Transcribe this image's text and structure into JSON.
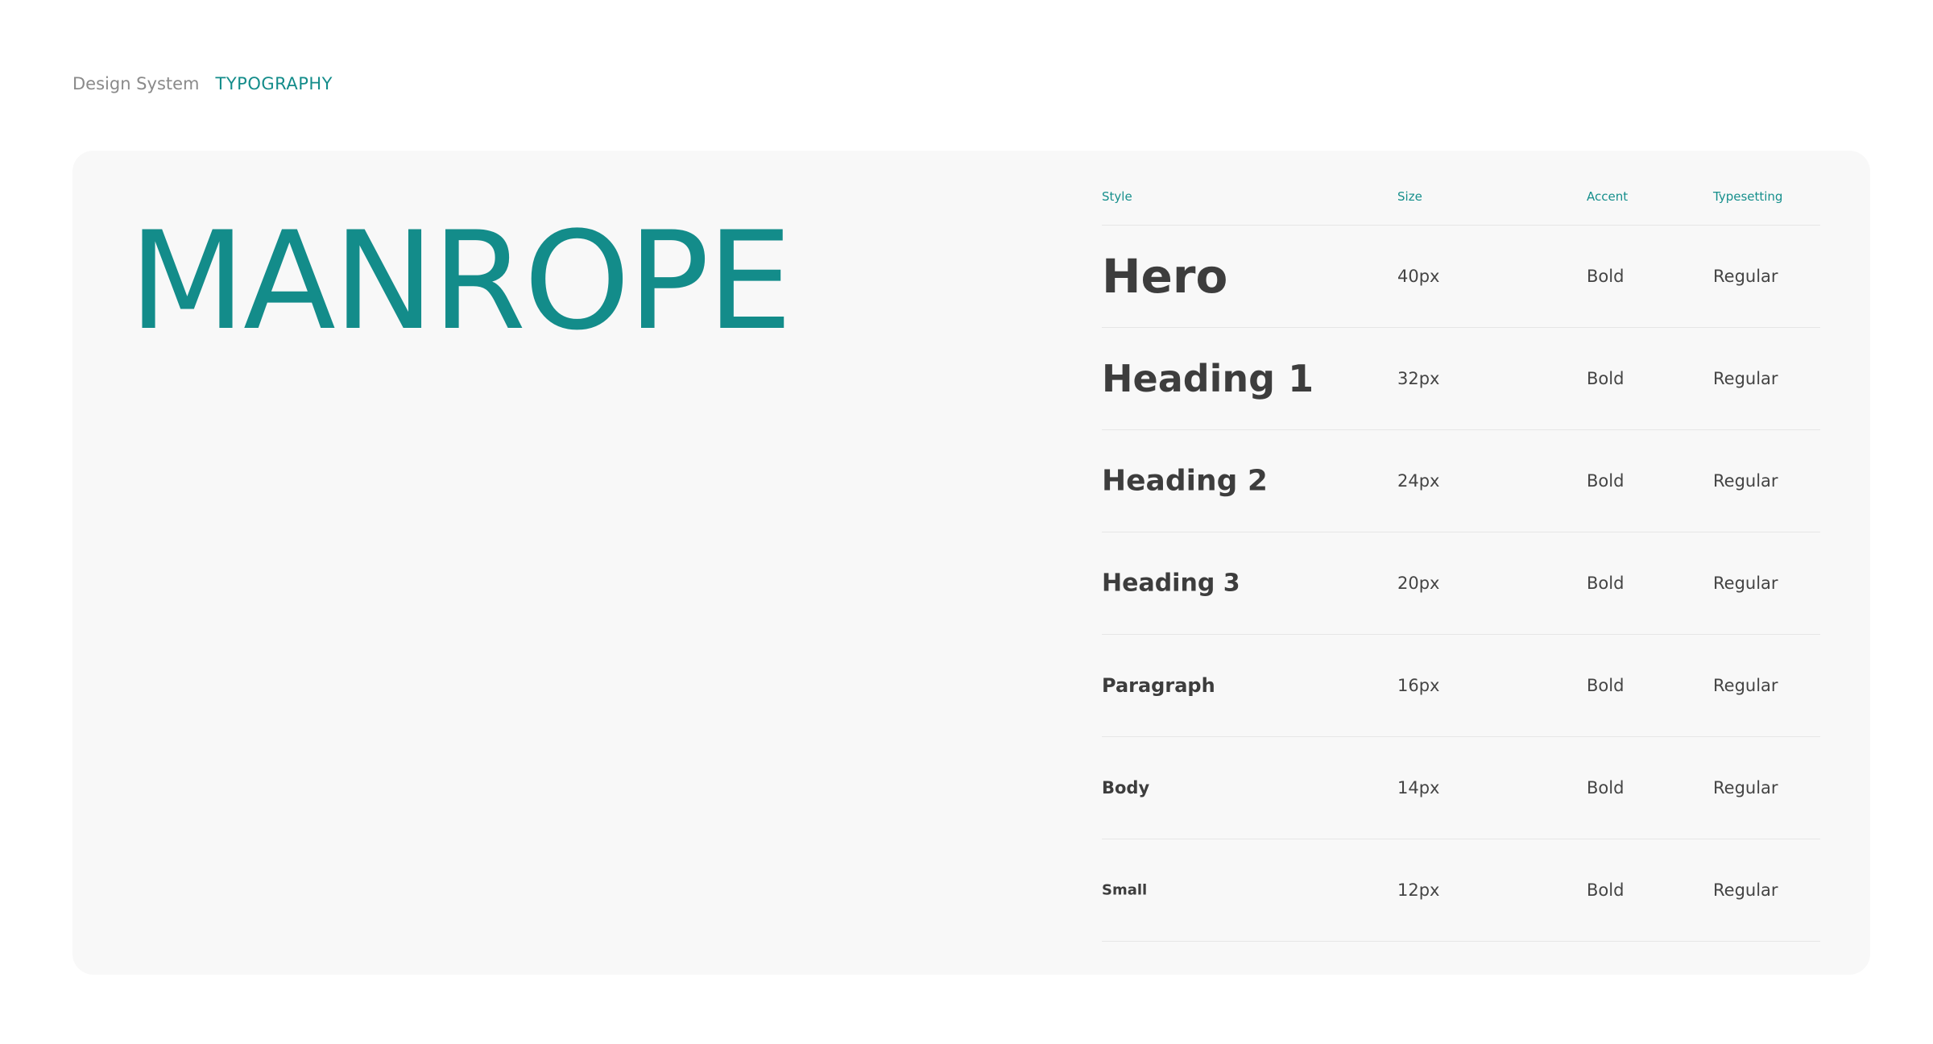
{
  "breadcrumb": {
    "root": "Design System",
    "current": "TYPOGRAPHY"
  },
  "font": {
    "name": "MANROPE"
  },
  "table": {
    "headers": {
      "style": "Style",
      "size": "Size",
      "accent": "Accent",
      "typesetting": "Typesetting"
    },
    "rows": [
      {
        "style": "Hero",
        "size": "40px",
        "accent": "Bold",
        "typesetting": "Regular"
      },
      {
        "style": "Heading 1",
        "size": "32px",
        "accent": "Bold",
        "typesetting": "Regular"
      },
      {
        "style": "Heading 2",
        "size": "24px",
        "accent": "Bold",
        "typesetting": "Regular"
      },
      {
        "style": "Heading 3",
        "size": "20px",
        "accent": "Bold",
        "typesetting": "Regular"
      },
      {
        "style": "Paragraph",
        "size": "16px",
        "accent": "Bold",
        "typesetting": "Regular"
      },
      {
        "style": "Body",
        "size": "14px",
        "accent": "Bold",
        "typesetting": "Regular"
      },
      {
        "style": "Small",
        "size": "12px",
        "accent": "Bold",
        "typesetting": "Regular"
      }
    ]
  },
  "colors": {
    "accent": "#138c8a",
    "text": "#3d3d3d",
    "card_background": "#f8f8f8",
    "divider": "#e6e6e6"
  }
}
